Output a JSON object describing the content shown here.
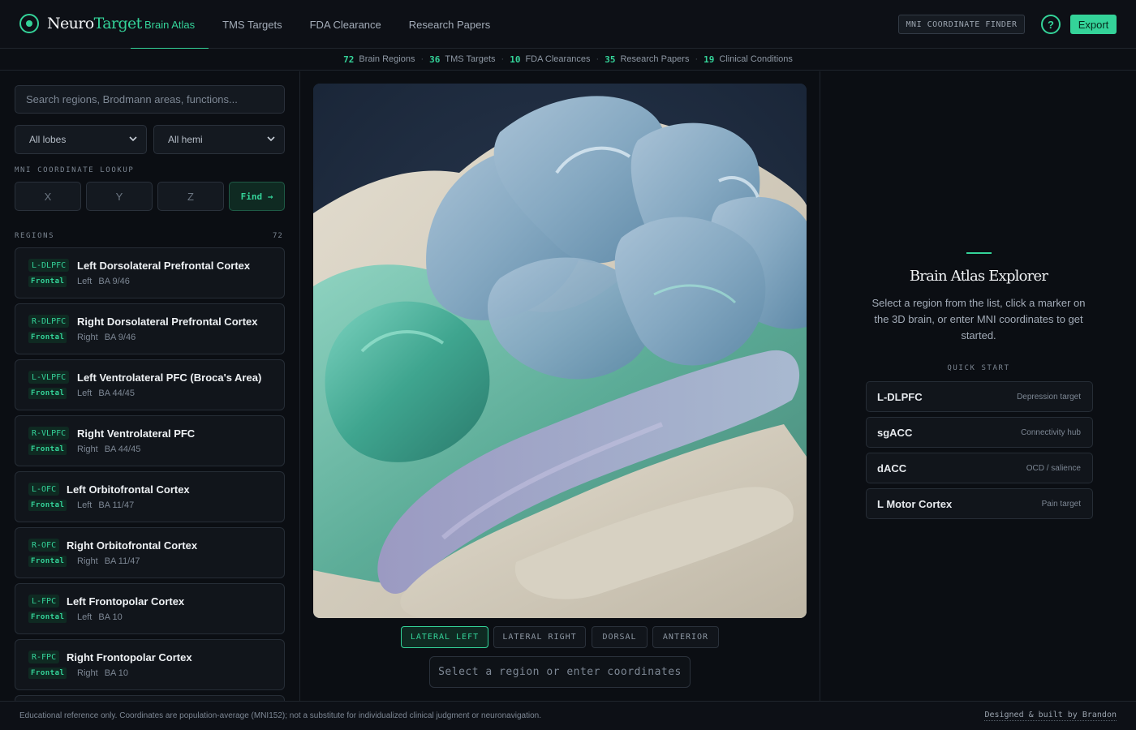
{
  "header": {
    "logo_neuro": "Neuro",
    "logo_target": "Target",
    "tabs": [
      {
        "label": "Brain Atlas",
        "active": true
      },
      {
        "label": "TMS Targets",
        "active": false
      },
      {
        "label": "FDA Clearance",
        "active": false
      },
      {
        "label": "Research Papers",
        "active": false
      }
    ],
    "mni_finder_label": "MNI COORDINATE FINDER",
    "help_label": "?",
    "export_label": "Export"
  },
  "stats": [
    {
      "num": "72",
      "label": "Brain Regions"
    },
    {
      "num": "36",
      "label": "TMS Targets"
    },
    {
      "num": "10",
      "label": "FDA Clearances"
    },
    {
      "num": "35",
      "label": "Research Papers"
    },
    {
      "num": "19",
      "label": "Clinical Conditions"
    }
  ],
  "sidebar": {
    "search_placeholder": "Search regions, Brodmann areas, functions...",
    "lobe_select": "All lobes",
    "hemi_select": "All hemi",
    "mni_label": "MNI COORDINATE LOOKUP",
    "x_placeholder": "X",
    "y_placeholder": "Y",
    "z_placeholder": "Z",
    "find_label": "Find →",
    "regions_label": "REGIONS",
    "regions_count": "72",
    "regions": [
      {
        "abbr": "L-DLPFC",
        "name": "Left Dorsolateral Prefrontal Cortex",
        "lobe": "Frontal",
        "hemi": "Left",
        "ba": "BA 9/46"
      },
      {
        "abbr": "R-DLPFC",
        "name": "Right Dorsolateral Prefrontal Cortex",
        "lobe": "Frontal",
        "hemi": "Right",
        "ba": "BA 9/46"
      },
      {
        "abbr": "L-VLPFC",
        "name": "Left Ventrolateral PFC (Broca's Area)",
        "lobe": "Frontal",
        "hemi": "Left",
        "ba": "BA 44/45"
      },
      {
        "abbr": "R-VLPFC",
        "name": "Right Ventrolateral PFC",
        "lobe": "Frontal",
        "hemi": "Right",
        "ba": "BA 44/45"
      },
      {
        "abbr": "L-OFC",
        "name": "Left Orbitofrontal Cortex",
        "lobe": "Frontal",
        "hemi": "Left",
        "ba": "BA 11/47"
      },
      {
        "abbr": "R-OFC",
        "name": "Right Orbitofrontal Cortex",
        "lobe": "Frontal",
        "hemi": "Right",
        "ba": "BA 11/47"
      },
      {
        "abbr": "L-FPC",
        "name": "Left Frontopolar Cortex",
        "lobe": "Frontal",
        "hemi": "Left",
        "ba": "BA 10"
      },
      {
        "abbr": "R-FPC",
        "name": "Right Frontopolar Cortex",
        "lobe": "Frontal",
        "hemi": "Right",
        "ba": "BA 10"
      }
    ]
  },
  "viewer": {
    "views": [
      {
        "label": "LATERAL LEFT",
        "active": true
      },
      {
        "label": "LATERAL RIGHT",
        "active": false
      },
      {
        "label": "DORSAL",
        "active": false
      },
      {
        "label": "ANTERIOR",
        "active": false
      }
    ],
    "status": "Select a region or enter coordinates"
  },
  "panel": {
    "title": "Brain Atlas Explorer",
    "description": "Select a region from the list, click a marker on the 3D brain, or enter MNI coordinates to get started.",
    "quick_start_label": "QUICK START",
    "quick_items": [
      {
        "name": "L-DLPFC",
        "desc": "Depression target"
      },
      {
        "name": "sgACC",
        "desc": "Connectivity hub"
      },
      {
        "name": "dACC",
        "desc": "OCD / salience"
      },
      {
        "name": "L Motor Cortex",
        "desc": "Pain target"
      }
    ]
  },
  "footer": {
    "disclaimer": "Educational reference only. Coordinates are population-average (MNI152); not a substitute for individualized clinical judgment or neuronavigation.",
    "credit": "Designed & built by Brandon"
  },
  "colors": {
    "accent": "#34d399",
    "background": "#0b0e13",
    "card": "#11151b",
    "viewer_bg": "#1e2b3f"
  }
}
